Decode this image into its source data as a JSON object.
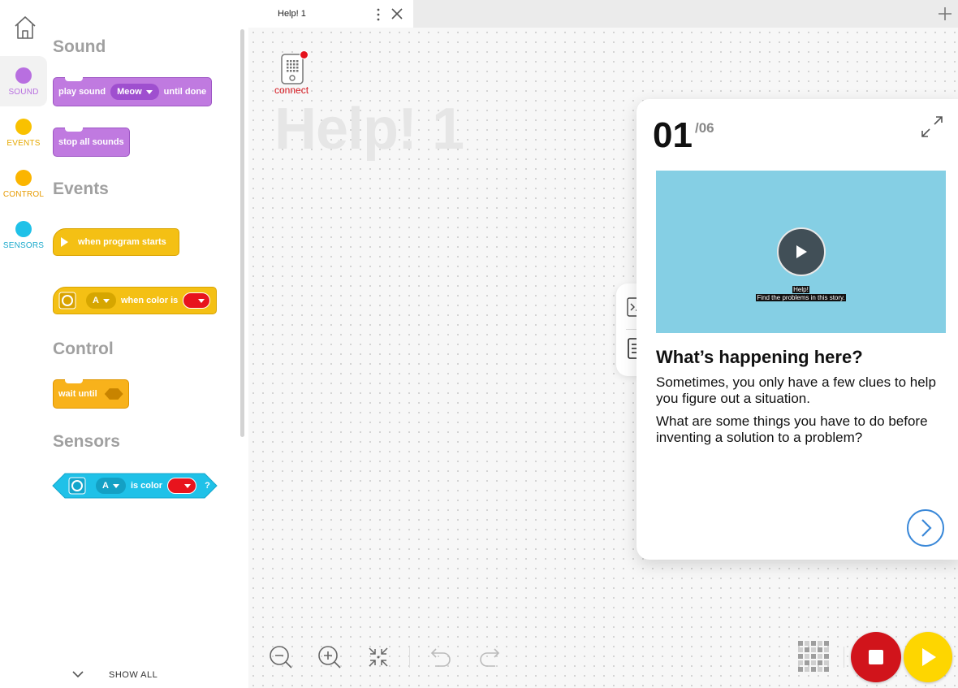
{
  "rail": {
    "categories": [
      {
        "label": "SOUND",
        "color": "#b86fe0"
      },
      {
        "label": "EVENTS",
        "color": "#f9c100"
      },
      {
        "label": "CONTROL",
        "color": "#fbb500"
      },
      {
        "label": "SENSORS",
        "color": "#1fc1e8"
      }
    ]
  },
  "palette": {
    "sections": {
      "sound": "Sound",
      "events": "Events",
      "control": "Control",
      "sensors": "Sensors"
    },
    "blocks": {
      "play_sound": {
        "prefix": "play sound",
        "value": "Meow",
        "suffix": "until done"
      },
      "stop_all_sounds": "stop all sounds",
      "when_program_starts": "when program starts",
      "when_color": {
        "port": "A",
        "label": "when color is",
        "color": "#e8141d"
      },
      "wait_until": "wait until",
      "is_color": {
        "port": "A",
        "label": "is color",
        "q": "?",
        "color": "#e8141d"
      }
    },
    "show_all": "SHOW ALL"
  },
  "tab": {
    "title": "Help! 1"
  },
  "canvas": {
    "hub_label": "connect",
    "project_title": "Help! 1"
  },
  "help": {
    "step": "01",
    "total": "/06",
    "video_caption_1": "Help!",
    "video_caption_2": "Find the problems in this story.",
    "question": "What’s happening here?",
    "paragraph_1": "Sometimes, you only have a few clues to help you figure out a situation.",
    "paragraph_2": "What are some things you have to do before inventing a solution to a problem?"
  },
  "colors": {
    "sound": "#c07ae0",
    "events": "#f4c014",
    "control": "#f8b21b",
    "sensors": "#1fc1e8",
    "stop": "#d1141b",
    "play": "#fed600",
    "accent": "#3a88d8"
  }
}
